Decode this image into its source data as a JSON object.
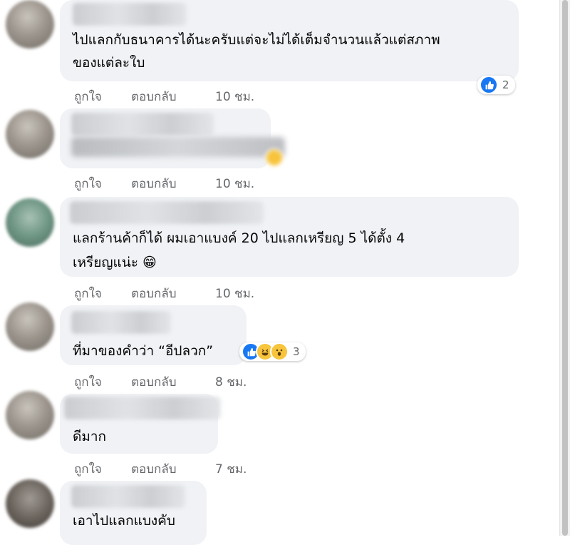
{
  "actions": {
    "like_label": "ถูกใจ",
    "reply_label": "ตอบกลับ"
  },
  "comments": [
    {
      "text_lines": [
        "ไปแลกกับธนาคารได้นะครับแต่จะไม่ได้เต็มจำนวนแล้วแต่สภาพ",
        "ของแต่ละใบ"
      ],
      "time": "10 ชม.",
      "reactions": [
        "like"
      ],
      "reaction_count": "2"
    },
    {
      "text_lines": [],
      "time": "10 ชม.",
      "reactions": [],
      "reaction_count": ""
    },
    {
      "text_lines": [
        "แลกร้านค้าก็ได้ ผมเอาแบงค์ 20 ไปแลกเหรียญ 5 ได้ตั้ง 4",
        "เหรียญแน่ะ 😁"
      ],
      "time": "10 ชม.",
      "reactions": [],
      "reaction_count": ""
    },
    {
      "text_lines": [
        "ที่มาของคำว่า “อีปลวก”"
      ],
      "time": "8 ชม.",
      "reactions": [
        "like",
        "haha",
        "wow"
      ],
      "reaction_count": "3"
    },
    {
      "text_lines": [
        "ดีมาก"
      ],
      "time": "7 ชม.",
      "reactions": [],
      "reaction_count": ""
    },
    {
      "text_lines": [
        "เอาไปแลกแบงคับ"
      ],
      "time": "",
      "reactions": [],
      "reaction_count": ""
    }
  ],
  "colors": {
    "bubble": "#f0f2f5",
    "action_text": "#65676b",
    "like_blue": "#1877f2",
    "emoji_yellow": "#f7c43c"
  }
}
